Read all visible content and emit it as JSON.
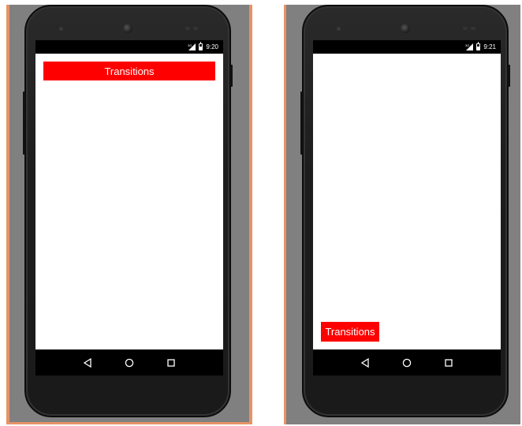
{
  "colors": {
    "button_bg": "#ff0000",
    "button_text": "#ffffff",
    "emulator_border": "#e69366",
    "emulator_bg": "#808080"
  },
  "left_device": {
    "status_time": "9:20",
    "button_label": "Transitions",
    "icons": [
      "signal-icon",
      "battery-icon",
      "back-icon",
      "home-icon",
      "recents-icon"
    ]
  },
  "right_device": {
    "status_time": "9:21",
    "button_label": "Transitions",
    "icons": [
      "signal-icon",
      "battery-icon",
      "back-icon",
      "home-icon",
      "recents-icon"
    ]
  }
}
